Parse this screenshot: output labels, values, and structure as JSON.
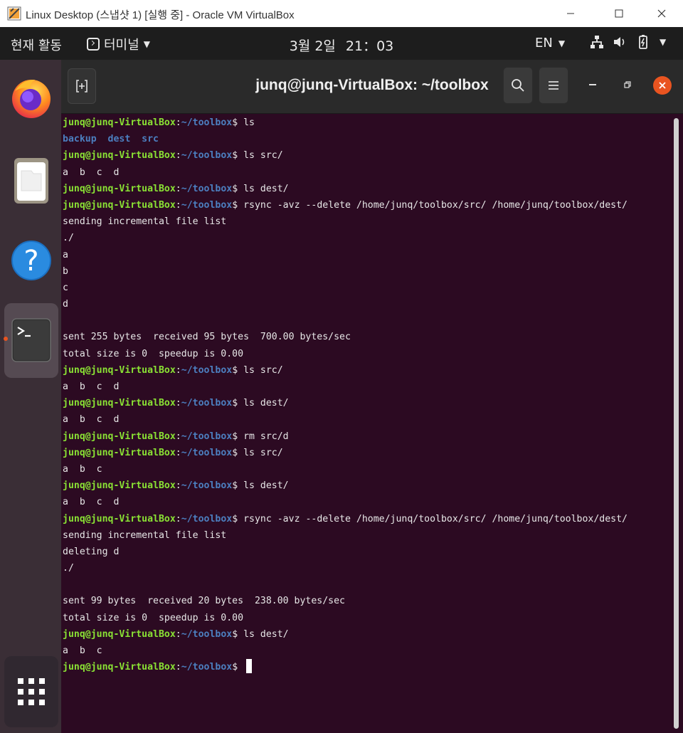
{
  "host_window": {
    "title": "Linux Desktop (스냅샷 1) [실행 중] - Oracle VM VirtualBox"
  },
  "topbar": {
    "activities": "현재 활동",
    "app_name": "터미널",
    "date": "3월 2일",
    "time": "21：03",
    "input_lang": "EN"
  },
  "dock": {
    "items": [
      "firefox",
      "files",
      "help",
      "terminal",
      "show-applications"
    ]
  },
  "terminal": {
    "title": "junq@junq-VirtualBox: ~/toolbox",
    "prompt_user": "junq@junq-VirtualBox",
    "prompt_path": "~/toolbox",
    "lines": [
      {
        "type": "cmd",
        "cmd": "ls"
      },
      {
        "type": "dirs",
        "text": "backup  dest  src"
      },
      {
        "type": "cmd",
        "cmd": "ls src/"
      },
      {
        "type": "out",
        "text": "a  b  c  d"
      },
      {
        "type": "cmd",
        "cmd": "ls dest/"
      },
      {
        "type": "cmd",
        "cmd": "rsync -avz --delete /home/junq/toolbox/src/ /home/junq/toolbox/dest/"
      },
      {
        "type": "out",
        "text": "sending incremental file list"
      },
      {
        "type": "out",
        "text": "./"
      },
      {
        "type": "out",
        "text": "a"
      },
      {
        "type": "out",
        "text": "b"
      },
      {
        "type": "out",
        "text": "c"
      },
      {
        "type": "out",
        "text": "d"
      },
      {
        "type": "out",
        "text": ""
      },
      {
        "type": "out",
        "text": "sent 255 bytes  received 95 bytes  700.00 bytes/sec"
      },
      {
        "type": "out",
        "text": "total size is 0  speedup is 0.00"
      },
      {
        "type": "cmd",
        "cmd": "ls src/"
      },
      {
        "type": "out",
        "text": "a  b  c  d"
      },
      {
        "type": "cmd",
        "cmd": "ls dest/"
      },
      {
        "type": "out",
        "text": "a  b  c  d"
      },
      {
        "type": "cmd",
        "cmd": "rm src/d"
      },
      {
        "type": "cmd",
        "cmd": "ls src/"
      },
      {
        "type": "out",
        "text": "a  b  c"
      },
      {
        "type": "cmd",
        "cmd": "ls dest/"
      },
      {
        "type": "out",
        "text": "a  b  c  d"
      },
      {
        "type": "cmd",
        "cmd": "rsync -avz --delete /home/junq/toolbox/src/ /home/junq/toolbox/dest/"
      },
      {
        "type": "out",
        "text": "sending incremental file list"
      },
      {
        "type": "out",
        "text": "deleting d"
      },
      {
        "type": "out",
        "text": "./"
      },
      {
        "type": "out",
        "text": ""
      },
      {
        "type": "out",
        "text": "sent 99 bytes  received 20 bytes  238.00 bytes/sec"
      },
      {
        "type": "out",
        "text": "total size is 0  speedup is 0.00"
      },
      {
        "type": "cmd",
        "cmd": "ls dest/"
      },
      {
        "type": "out",
        "text": "a  b  c"
      },
      {
        "type": "cursor",
        "cmd": ""
      }
    ]
  },
  "colors": {
    "terminal_bg": "#2c0a22",
    "prompt_user": "#8ae234",
    "prompt_path": "#4c7fc0",
    "accent": "#e95420"
  }
}
